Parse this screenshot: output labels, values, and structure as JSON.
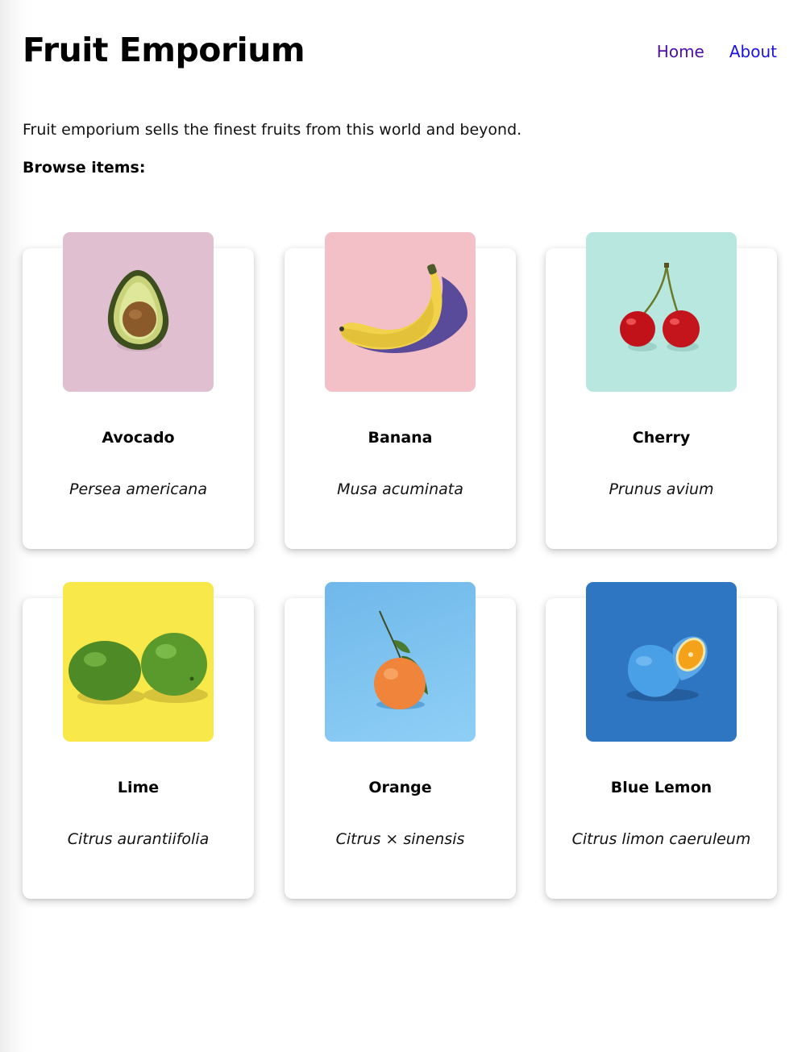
{
  "header": {
    "title": "Fruit Emporium",
    "nav": [
      {
        "label": "Home"
      },
      {
        "label": "About"
      }
    ]
  },
  "main": {
    "intro": "Fruit emporium sells the finest fruits from this world and beyond.",
    "browse_label": "Browse items:",
    "items": [
      {
        "name": "Avocado",
        "latin": "Persea americana",
        "image_icon": "avocado-icon",
        "bg": "#dfbfd0"
      },
      {
        "name": "Banana",
        "latin": "Musa acuminata",
        "image_icon": "banana-icon",
        "bg": "#f3c0c8"
      },
      {
        "name": "Cherry",
        "latin": "Prunus avium",
        "image_icon": "cherry-icon",
        "bg": "#b7e7df"
      },
      {
        "name": "Lime",
        "latin": "Citrus aurantiifolia",
        "image_icon": "lime-icon",
        "bg": "#f8e84a"
      },
      {
        "name": "Orange",
        "latin": "Citrus × sinensis",
        "image_icon": "orange-icon",
        "bg": "#7bc0ef"
      },
      {
        "name": "Blue Lemon",
        "latin": "Citrus limon caeruleum",
        "image_icon": "blue-lemon-icon",
        "bg": "#2f76c2"
      }
    ]
  },
  "colors": {
    "nav_visited": "#4d0fa8",
    "nav_link": "#1b12e0"
  }
}
